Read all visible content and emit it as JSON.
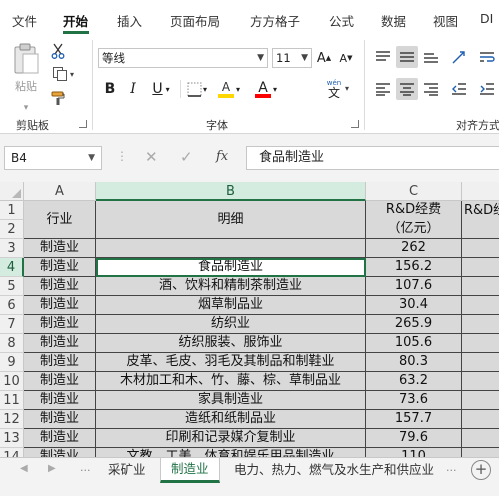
{
  "ribbon_tabs": [
    "文件",
    "开始",
    "插入",
    "页面布局",
    "方方格子",
    "公式",
    "数据",
    "视图",
    "DI"
  ],
  "clipboard": {
    "paste_label": "粘贴",
    "group_label": "剪贴板"
  },
  "font": {
    "name": "等线",
    "size": "11",
    "grow": "A",
    "shrink": "A",
    "bold": "B",
    "italic": "I",
    "underline": "U",
    "highlight": "A",
    "color": "A",
    "wen": "wén",
    "wen_char": "文",
    "group_label": "字体"
  },
  "alignment": {
    "group_label": "对齐方式"
  },
  "colors": {
    "accent": "#217346",
    "highlight_yellow": "#ffd700",
    "font_red": "#ff0000",
    "cell_fill": "#d9d9d9"
  },
  "formula_bar": {
    "name_box": "B4",
    "fx_label": "fx",
    "formula": "食品制造业"
  },
  "grid": {
    "columns": [
      "A",
      "B",
      "C",
      ""
    ],
    "rows": [
      "1",
      "2",
      "3",
      "4",
      "5",
      "6",
      "7",
      "8",
      "9",
      "10",
      "11",
      "12",
      "13",
      "14"
    ],
    "header": {
      "a": "行业",
      "b": "明细",
      "c1": "R&D经费",
      "c2": "（亿元）",
      "d": "R&D经"
    },
    "data": [
      {
        "a": "制造业",
        "b": "",
        "c": "262"
      },
      {
        "a": "制造业",
        "b": "食品制造业",
        "c": "156.2"
      },
      {
        "a": "制造业",
        "b": "酒、饮料和精制茶制造业",
        "c": "107.6"
      },
      {
        "a": "制造业",
        "b": "烟草制品业",
        "c": "30.4"
      },
      {
        "a": "制造业",
        "b": "纺织业",
        "c": "265.9"
      },
      {
        "a": "制造业",
        "b": "纺织服装、服饰业",
        "c": "105.6"
      },
      {
        "a": "制造业",
        "b": "皮革、毛皮、羽毛及其制品和制鞋业",
        "c": "80.3"
      },
      {
        "a": "制造业",
        "b": "木材加工和木、竹、藤、棕、草制品业",
        "c": "63.2"
      },
      {
        "a": "制造业",
        "b": "家具制造业",
        "c": "73.6"
      },
      {
        "a": "制造业",
        "b": "造纸和纸制品业",
        "c": "157.7"
      },
      {
        "a": "制造业",
        "b": "印刷和记录媒介复制业",
        "c": "79.6"
      },
      {
        "a": "制造业",
        "b": "文教、工美、体育和娱乐用品制造业",
        "c": "110"
      }
    ]
  },
  "sheet_tabs": [
    "采矿业",
    "制造业",
    "电力、热力、燃气及水生产和供应业"
  ],
  "sheet_nav": {
    "prev": "◀",
    "next": "▶",
    "more": "...",
    "add": "+"
  }
}
